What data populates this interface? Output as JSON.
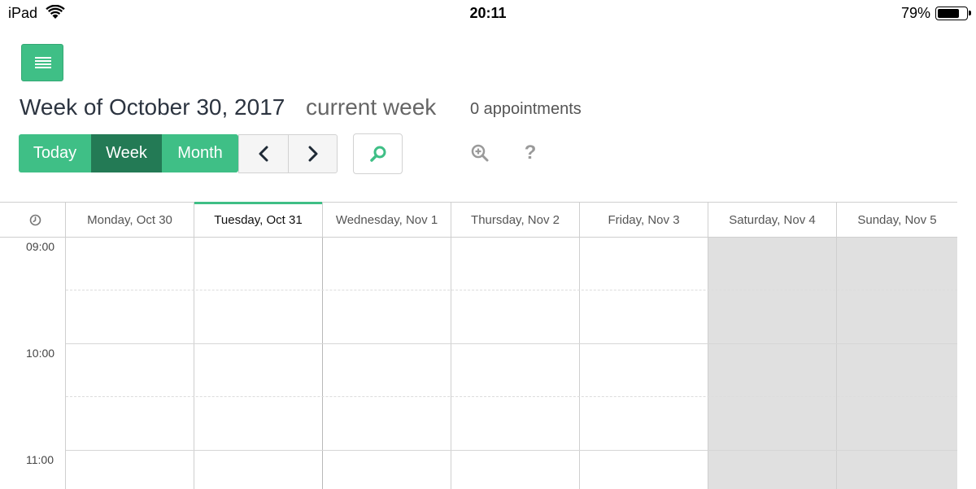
{
  "status_bar": {
    "device": "iPad",
    "time": "20:11",
    "battery_percent_label": "79%",
    "battery_level": 0.79,
    "wifi_icon": "wifi-icon",
    "battery_icon": "battery-icon"
  },
  "header": {
    "menu_icon": "hamburger-menu-icon",
    "title": "Week of October 30, 2017",
    "week_label": "current week",
    "appointment_count": "0 appointments"
  },
  "toolbar": {
    "view_buttons": [
      {
        "label": "Today"
      },
      {
        "label": "Week",
        "selected": true
      },
      {
        "label": "Month"
      }
    ],
    "prev_icon": "chevron-left-icon",
    "next_icon": "chevron-right-icon",
    "search_icon": "search-icon",
    "zoom_icon": "zoom-in-icon",
    "help_label": "?"
  },
  "colors": {
    "accent": "#3fbf86",
    "accent_dark": "#237a55",
    "weekend_bg": "#e0e0e0"
  },
  "calendar": {
    "time_header_icon": "clock-icon",
    "days": [
      {
        "label": "Monday, Oct 30",
        "today": false,
        "weekend": false
      },
      {
        "label": "Tuesday, Oct 31",
        "today": true,
        "weekend": false
      },
      {
        "label": "Wednesday, Nov 1",
        "today": false,
        "weekend": false
      },
      {
        "label": "Thursday, Nov 2",
        "today": false,
        "weekend": false
      },
      {
        "label": "Friday, Nov 3",
        "today": false,
        "weekend": false
      },
      {
        "label": "Saturday, Nov 4",
        "today": false,
        "weekend": true
      },
      {
        "label": "Sunday, Nov 5",
        "today": false,
        "weekend": true
      }
    ],
    "hours": [
      "09:00",
      "10:00",
      "11:00"
    ]
  }
}
